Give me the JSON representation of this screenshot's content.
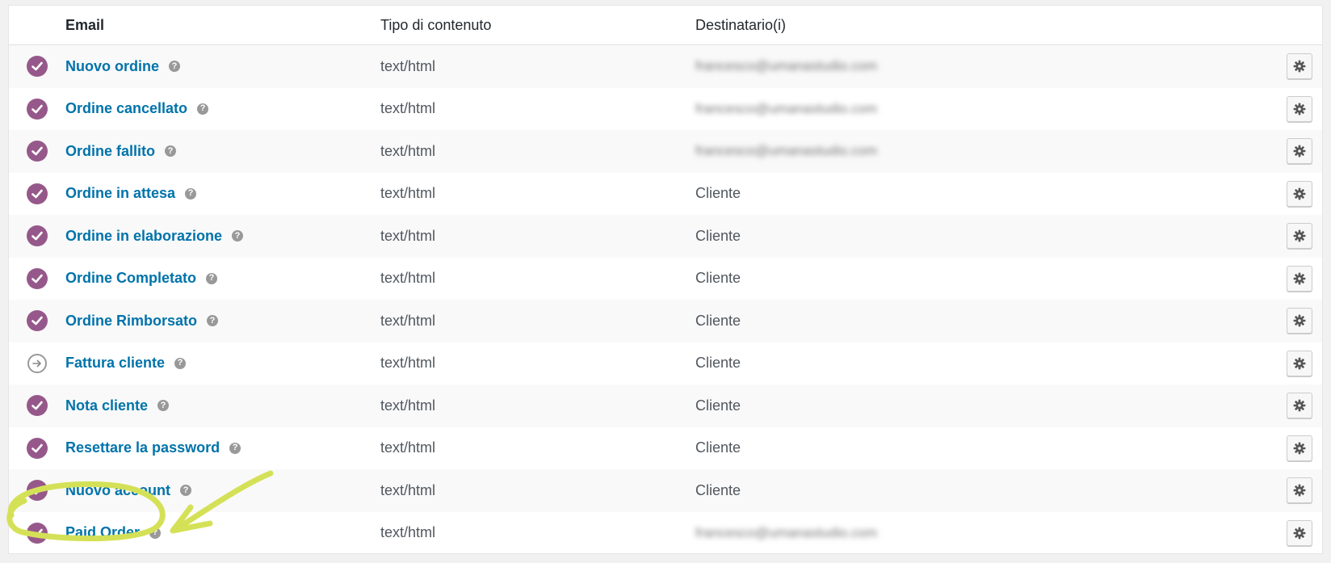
{
  "headers": {
    "email": "Email",
    "content_type": "Tipo di contenuto",
    "recipients": "Destinatario(i)"
  },
  "help_glyph": "?",
  "rows": [
    {
      "name": "Nuovo ordine",
      "content_type": "text/html",
      "recipient": "francesco@umanastudio.com",
      "status": "enabled",
      "recipient_blurred": true
    },
    {
      "name": "Ordine cancellato",
      "content_type": "text/html",
      "recipient": "francesco@umanastudio.com",
      "status": "enabled",
      "recipient_blurred": true
    },
    {
      "name": "Ordine fallito",
      "content_type": "text/html",
      "recipient": "francesco@umanastudio.com",
      "status": "enabled",
      "recipient_blurred": true
    },
    {
      "name": "Ordine in attesa",
      "content_type": "text/html",
      "recipient": "Cliente",
      "status": "enabled",
      "recipient_blurred": false
    },
    {
      "name": "Ordine in elaborazione",
      "content_type": "text/html",
      "recipient": "Cliente",
      "status": "enabled",
      "recipient_blurred": false
    },
    {
      "name": "Ordine Completato",
      "content_type": "text/html",
      "recipient": "Cliente",
      "status": "enabled",
      "recipient_blurred": false
    },
    {
      "name": "Ordine Rimborsato",
      "content_type": "text/html",
      "recipient": "Cliente",
      "status": "enabled",
      "recipient_blurred": false
    },
    {
      "name": "Fattura cliente",
      "content_type": "text/html",
      "recipient": "Cliente",
      "status": "manual",
      "recipient_blurred": false
    },
    {
      "name": "Nota cliente",
      "content_type": "text/html",
      "recipient": "Cliente",
      "status": "enabled",
      "recipient_blurred": false
    },
    {
      "name": "Resettare la password",
      "content_type": "text/html",
      "recipient": "Cliente",
      "status": "enabled",
      "recipient_blurred": false
    },
    {
      "name": "Nuovo account",
      "content_type": "text/html",
      "recipient": "Cliente",
      "status": "enabled",
      "recipient_blurred": false
    },
    {
      "name": "Paid Order",
      "content_type": "text/html",
      "recipient": "francesco@umanastudio.com",
      "status": "enabled",
      "recipient_blurred": true
    }
  ],
  "icons": {
    "enabled": "check-circle-icon",
    "manual": "arrow-right-circle-icon",
    "help": "help-icon",
    "settings": "gear-icon"
  },
  "colors": {
    "link": "#0073aa",
    "status_enabled": "#96588a",
    "annotation_highlight": "#d4e157"
  }
}
